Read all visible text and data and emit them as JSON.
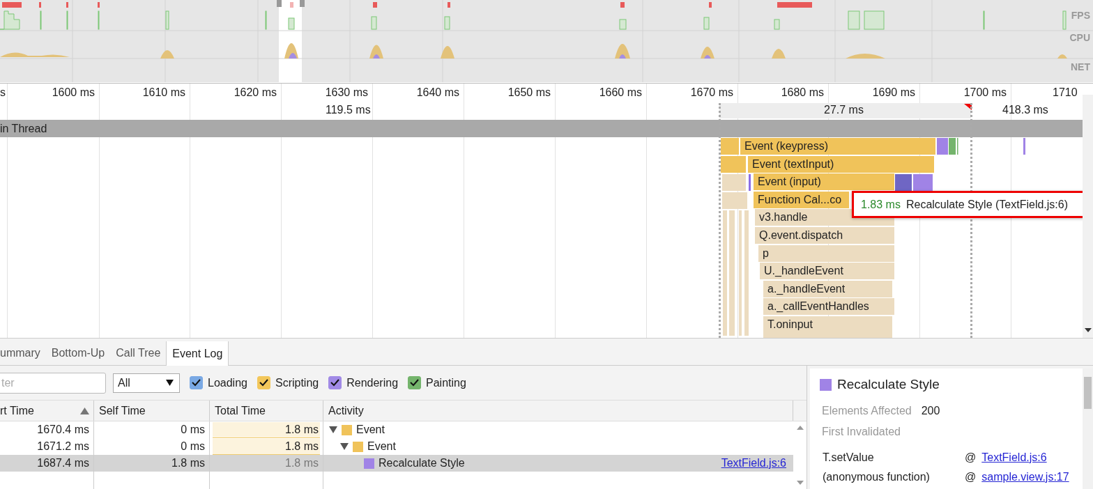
{
  "overview": {
    "lanes": [
      {
        "label": "FPS"
      },
      {
        "label": "CPU"
      },
      {
        "label": "NET"
      }
    ]
  },
  "ruler": {
    "ticks": [
      "s",
      "1600 ms",
      "1610 ms",
      "1620 ms",
      "1630 ms",
      "1640 ms",
      "1650 ms",
      "1660 ms",
      "1670 ms",
      "1680 ms",
      "1690 ms",
      "1700 ms",
      "1710"
    ]
  },
  "markers": [
    "119.5 ms",
    "27.7 ms",
    "418.3 ms"
  ],
  "thread": {
    "title": "in Thread"
  },
  "flame": [
    {
      "label": "Event (keypress)",
      "kind": "scripting"
    },
    {
      "label": "Event (textInput)",
      "kind": "scripting"
    },
    {
      "label": "Event (input)",
      "kind": "scripting"
    },
    {
      "label": "Function Cal...co",
      "kind": "scripting"
    },
    {
      "label": "v3.handle",
      "kind": "dimmed"
    },
    {
      "label": "Q.event.dispatch",
      "kind": "dimmed"
    },
    {
      "label": "p",
      "kind": "dimmed"
    },
    {
      "label": "U._handleEvent",
      "kind": "dimmed"
    },
    {
      "label": "a._handleEvent",
      "kind": "dimmed"
    },
    {
      "label": "a._callEventHandles",
      "kind": "dimmed"
    },
    {
      "label": "T.oninput",
      "kind": "dimmed"
    }
  ],
  "tooltip": {
    "duration": "1.83 ms",
    "text": "Recalculate Style (TextField.js:6)"
  },
  "tabs": [
    {
      "label": "ummary",
      "selected": false
    },
    {
      "label": "Bottom-Up",
      "selected": false
    },
    {
      "label": "Call Tree",
      "selected": false
    },
    {
      "label": "Event Log",
      "selected": true
    }
  ],
  "filter": {
    "placeholder": "ter",
    "dropdown": "All"
  },
  "categories": [
    {
      "label": "Loading",
      "checked": true,
      "color": "#7aa9e4"
    },
    {
      "label": "Scripting",
      "checked": true,
      "color": "#f3c75b"
    },
    {
      "label": "Rendering",
      "checked": true,
      "color": "#a18ae6"
    },
    {
      "label": "Painting",
      "checked": true,
      "color": "#74b46c"
    }
  ],
  "table": {
    "columns": [
      {
        "label": "rt Time",
        "sorted": true
      },
      {
        "label": "Self Time",
        "sorted": false
      },
      {
        "label": "Total Time",
        "sorted": false
      },
      {
        "label": "Activity",
        "sorted": false
      }
    ],
    "rows": [
      {
        "start": "1670.4 ms",
        "self": "0 ms",
        "total": "1.8 ms",
        "activity": "Event",
        "color": "#f0c35a",
        "expanded": true,
        "selected": false,
        "children": [
          {
            "start": "1671.2 ms",
            "self": "0 ms",
            "total": "1.8 ms",
            "activity": "Event",
            "color": "#f0c35a",
            "expanded": true,
            "selected": false,
            "children": [
              {
                "start": "1687.4 ms",
                "self": "1.8 ms",
                "total": "1.8 ms",
                "activity": "Recalculate Style",
                "color": "#a083e6",
                "link": "TextField.js:6",
                "selected": true
              }
            ]
          }
        ]
      }
    ]
  },
  "details": {
    "title": "Recalculate Style",
    "color": "#a083e6",
    "fields": [
      {
        "label": "Elements Affected",
        "value": "200"
      },
      {
        "label": "First Invalidated"
      }
    ],
    "stack": [
      {
        "function": "T.setValue",
        "at": "@",
        "link": "TextField.js:6"
      },
      {
        "function": "(anonymous function)",
        "at": "@",
        "link": "sample.view.js:17"
      }
    ]
  }
}
